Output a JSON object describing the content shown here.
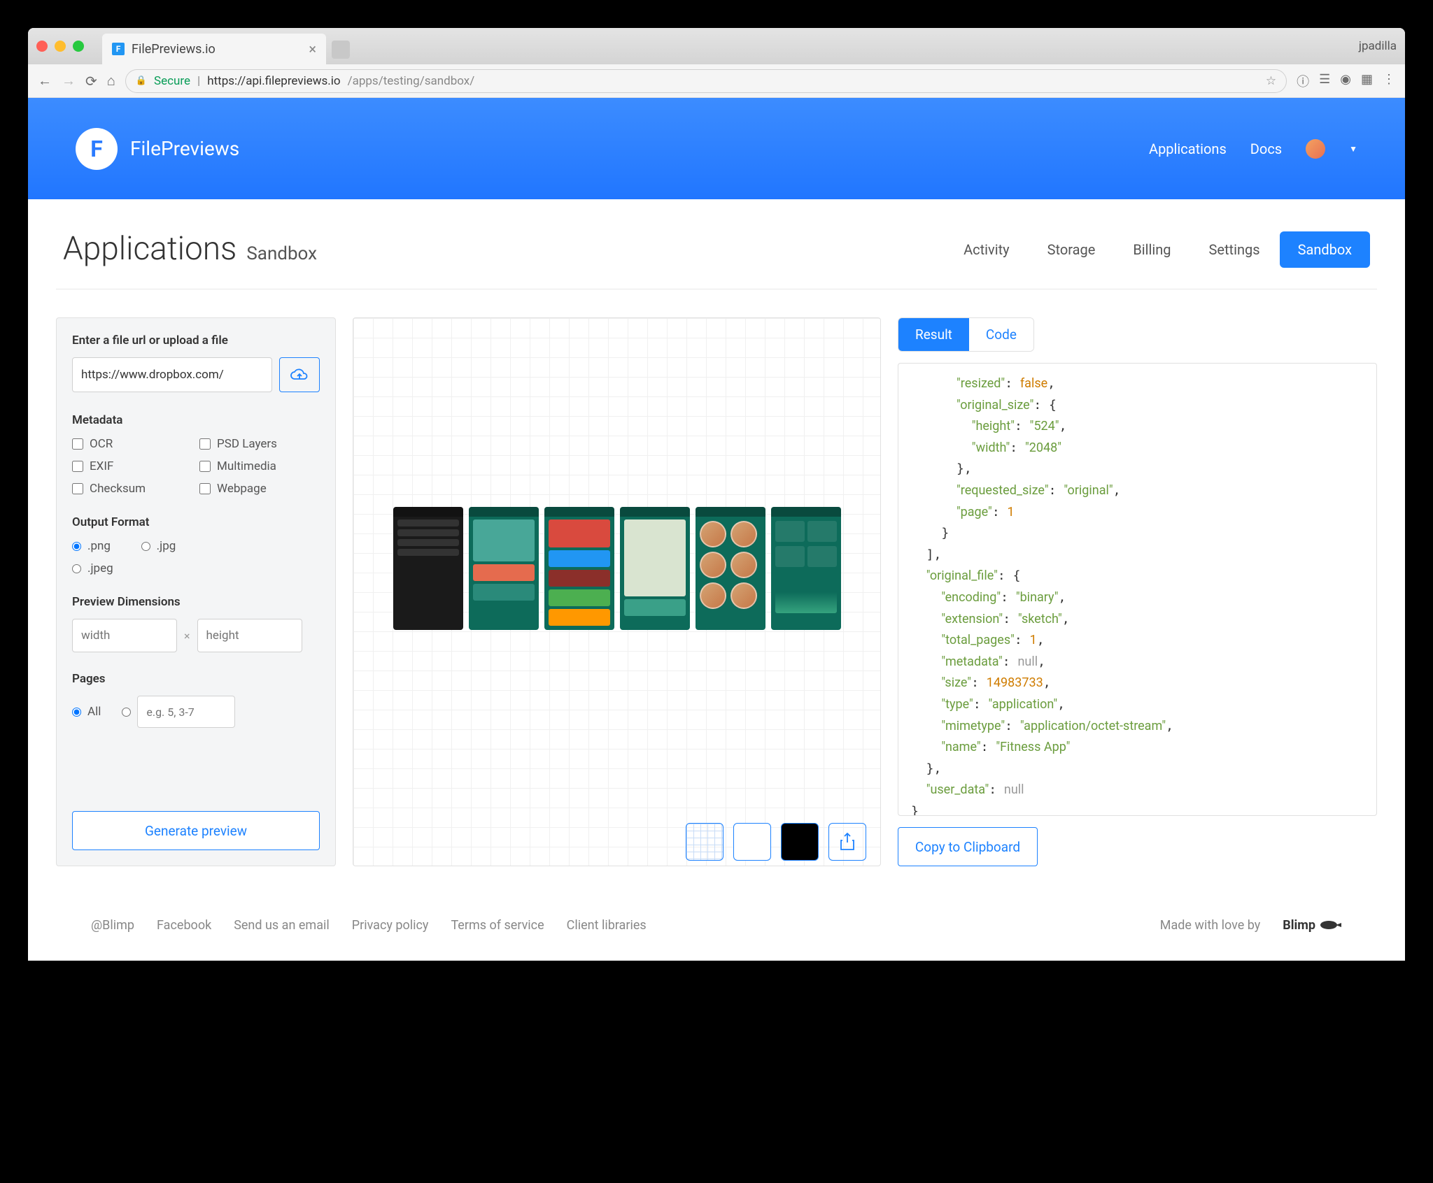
{
  "browser": {
    "tab_title": "FilePreviews.io",
    "profile": "jpadilla",
    "secure_label": "Secure",
    "url_host": "https://api.filepreviews.io",
    "url_path": "/apps/testing/sandbox/"
  },
  "header": {
    "brand": "FilePreviews",
    "nav": {
      "applications": "Applications",
      "docs": "Docs"
    }
  },
  "page": {
    "title": "Applications",
    "subtitle": "Sandbox",
    "tabs": {
      "activity": "Activity",
      "storage": "Storage",
      "billing": "Billing",
      "settings": "Settings",
      "sandbox": "Sandbox"
    }
  },
  "left": {
    "upload_label": "Enter a file url or upload a file",
    "url_value": "https://www.dropbox.com/",
    "metadata_label": "Metadata",
    "metadata": {
      "ocr": "OCR",
      "psd": "PSD Layers",
      "exif": "EXIF",
      "multimedia": "Multimedia",
      "checksum": "Checksum",
      "webpage": "Webpage"
    },
    "format_label": "Output Format",
    "formats": {
      "png": ".png",
      "jpg": ".jpg",
      "jpeg": ".jpeg"
    },
    "dims_label": "Preview Dimensions",
    "width_ph": "width",
    "height_ph": "height",
    "pages_label": "Pages",
    "pages_all": "All",
    "pages_ph": "e.g. 5, 3-7",
    "generate": "Generate preview"
  },
  "right": {
    "tab_result": "Result",
    "tab_code": "Code",
    "copy": "Copy to Clipboard",
    "json": {
      "resized": "false",
      "original_size": {
        "height": "524",
        "width": "2048"
      },
      "requested_size": "original",
      "page": "1",
      "original_file": {
        "encoding": "binary",
        "extension": "sketch",
        "total_pages": "1",
        "metadata": "null",
        "size": "14983733",
        "type": "application",
        "mimetype": "application/octet-stream",
        "name": "Fitness App"
      },
      "user_data": "null"
    }
  },
  "footer": {
    "blimp": "@Blimp",
    "fb": "Facebook",
    "email": "Send us an email",
    "privacy": "Privacy policy",
    "tos": "Terms of service",
    "libs": "Client libraries",
    "made": "Made with love by",
    "brand": "Blimp"
  }
}
